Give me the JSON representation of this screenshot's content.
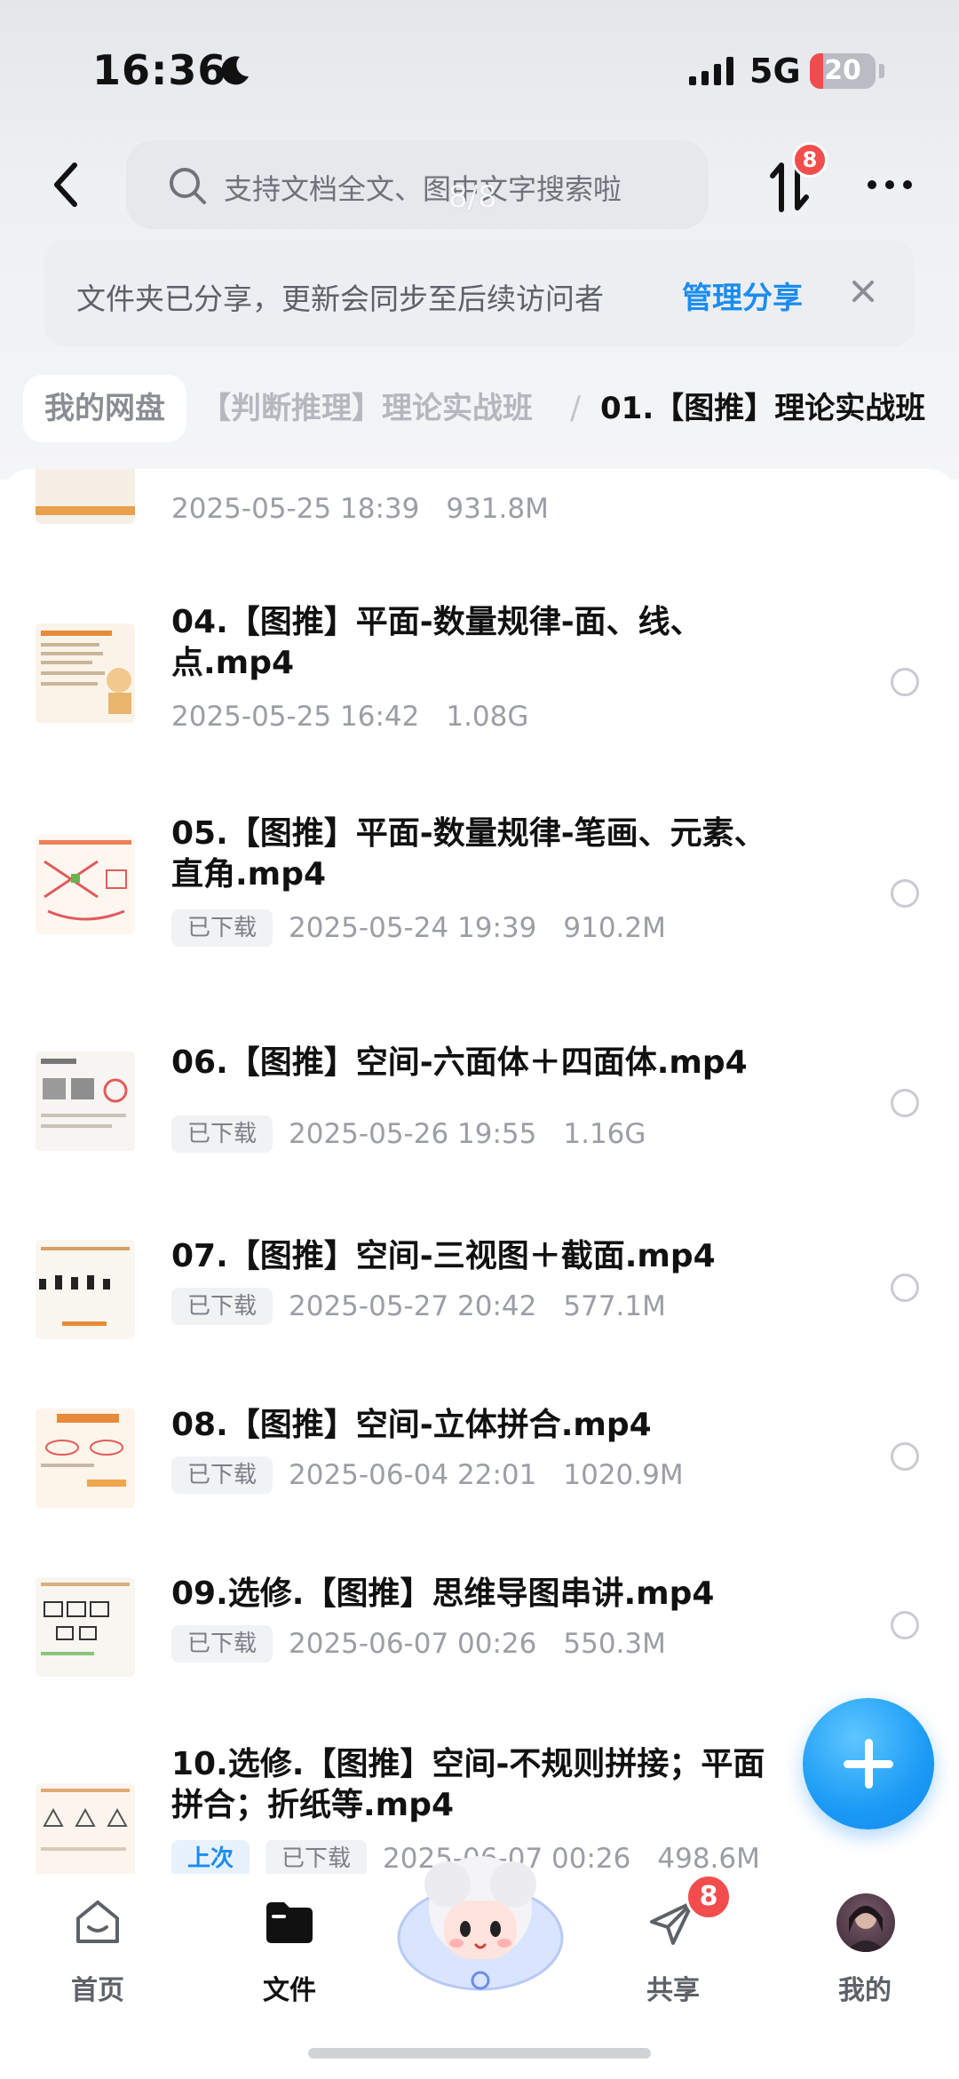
{
  "status_bar": {
    "time": "16:36",
    "network": "5G",
    "battery": "20",
    "battery_level": 0.2
  },
  "header": {
    "search_placeholder": "支持文档全文、图中文字搜索啦",
    "page_indicator": "8/8",
    "transfer_badge": "8"
  },
  "share_banner": {
    "text": "文件夹已分享，更新会同步至后续访问者",
    "manage_label": "管理分享"
  },
  "breadcrumb": {
    "root": "我的网盘",
    "parent": "【判断推理】理论实战班",
    "separator": "/",
    "current": "01.【图推】理论实战班"
  },
  "files": [
    {
      "name": "",
      "tags": [],
      "date": "2025-05-25 18:39",
      "size": "931.8M"
    },
    {
      "name": "04.【图推】平面-数量规律-面、线、点.mp4",
      "tags": [],
      "date": "2025-05-25 16:42",
      "size": "1.08G"
    },
    {
      "name": "05.【图推】平面-数量规律-笔画、元素、直角.mp4",
      "tags": [
        "已下载"
      ],
      "date": "2025-05-24 19:39",
      "size": "910.2M"
    },
    {
      "name": "06.【图推】空间-六面体＋四面体.mp4",
      "tags": [
        "已下载"
      ],
      "date": "2025-05-26 19:55",
      "size": "1.16G"
    },
    {
      "name": "07.【图推】空间-三视图＋截面.mp4",
      "tags": [
        "已下载"
      ],
      "date": "2025-05-27 20:42",
      "size": "577.1M"
    },
    {
      "name": "08.【图推】空间-立体拼合.mp4",
      "tags": [
        "已下载"
      ],
      "date": "2025-06-04 22:01",
      "size": "1020.9M"
    },
    {
      "name": "09.选修.【图推】思维导图串讲.mp4",
      "tags": [
        "已下载"
      ],
      "date": "2025-06-07 00:26",
      "size": "550.3M"
    },
    {
      "name": "10.选修.【图推】空间-不规则拼接；平面拼合；折纸等.mp4",
      "tags": [
        "上次",
        "已下载"
      ],
      "date": "2025-06-07 00:26",
      "size": "498.6M"
    }
  ],
  "bottom_nav": {
    "home": "首页",
    "files": "文件",
    "share": "共享",
    "share_badge": "8",
    "me": "我的"
  },
  "colors": {
    "accent": "#1a8cf0",
    "badge": "#f24d4d",
    "fab": "#1a9bf5"
  }
}
